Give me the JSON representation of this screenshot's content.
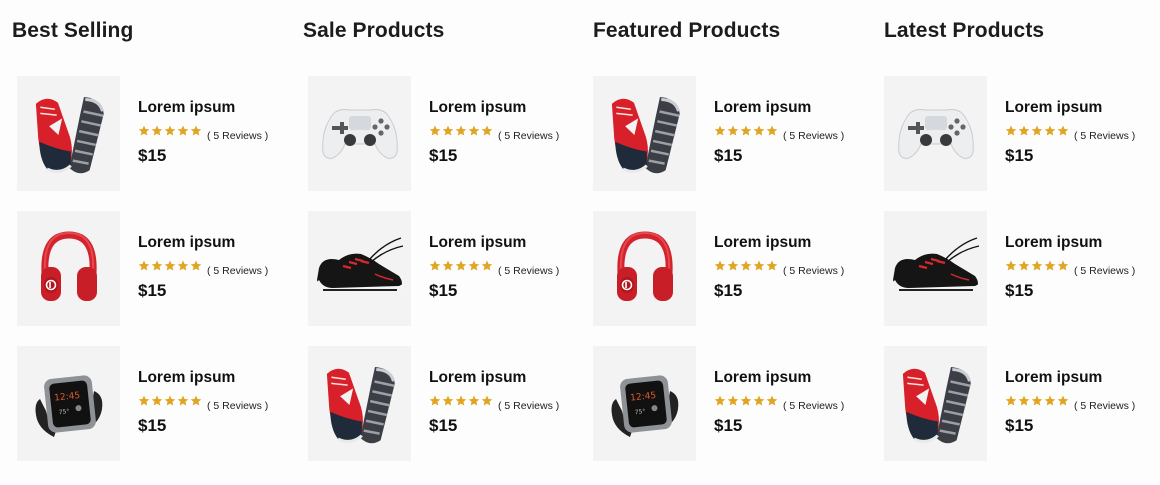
{
  "sections": [
    {
      "title": "Best Selling",
      "products": [
        {
          "image": "sneaker-red-icon",
          "name": "Lorem ipsum",
          "reviews": "( 5 Reviews )",
          "price": "$15",
          "rating": 5
        },
        {
          "image": "headphones-red-icon",
          "name": "Lorem ipsum",
          "reviews": "( 5 Reviews )",
          "price": "$15",
          "rating": 5
        },
        {
          "image": "smartwatch-icon",
          "name": "Lorem ipsum",
          "reviews": "( 5 Reviews )",
          "price": "$15",
          "rating": 5
        }
      ]
    },
    {
      "title": "Sale Products",
      "products": [
        {
          "image": "gamepad-white-icon",
          "name": "Lorem ipsum",
          "reviews": "( 5 Reviews )",
          "price": "$15",
          "rating": 5
        },
        {
          "image": "sneaker-black-icon",
          "name": "Lorem ipsum",
          "reviews": "( 5 Reviews )",
          "price": "$15",
          "rating": 5
        },
        {
          "image": "sneaker-red-icon",
          "name": "Lorem ipsum",
          "reviews": "( 5 Reviews )",
          "price": "$15",
          "rating": 5
        }
      ]
    },
    {
      "title": "Featured Products",
      "products": [
        {
          "image": "sneaker-red-icon",
          "name": "Lorem ipsum",
          "reviews": "( 5 Reviews )",
          "price": "$15",
          "rating": 5
        },
        {
          "image": "headphones-red-icon",
          "name": "Lorem ipsum",
          "reviews": "( 5 Reviews )",
          "price": "$15",
          "rating": 5
        },
        {
          "image": "smartwatch-icon",
          "name": "Lorem ipsum",
          "reviews": "( 5 Reviews )",
          "price": "$15",
          "rating": 5
        }
      ]
    },
    {
      "title": "Latest Products",
      "products": [
        {
          "image": "gamepad-white-icon",
          "name": "Lorem ipsum",
          "reviews": "( 5 Reviews )",
          "price": "$15",
          "rating": 5
        },
        {
          "image": "sneaker-black-icon",
          "name": "Lorem ipsum",
          "reviews": "( 5 Reviews )",
          "price": "$15",
          "rating": 5
        },
        {
          "image": "sneaker-red-icon",
          "name": "Lorem ipsum",
          "reviews": "( 5 Reviews )",
          "price": "$15",
          "rating": 5
        }
      ]
    }
  ],
  "colors": {
    "star": "#e0a623",
    "thumb_bg": "#f3f3f3",
    "title": "#1c1c1c"
  }
}
